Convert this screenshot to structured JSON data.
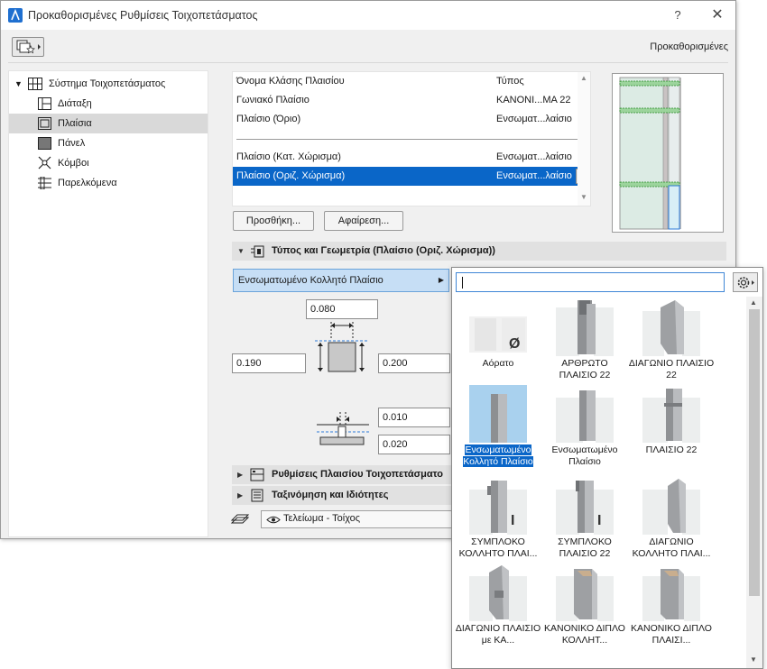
{
  "window": {
    "title": "Προκαθορισμένες Ρυθμίσεις Τοιχοπετάσματος",
    "help": "?",
    "close": "✕",
    "defaults_label": "Προκαθορισμένες"
  },
  "tree": {
    "root": "Σύστημα Τοιχοπετάσματος",
    "items": [
      {
        "label": "Διάταξη",
        "icon": "layout-icon"
      },
      {
        "label": "Πλαίσια",
        "icon": "frames-icon",
        "selected": true
      },
      {
        "label": "Πάνελ",
        "icon": "panel-icon"
      },
      {
        "label": "Κόμβοι",
        "icon": "junctions-icon"
      },
      {
        "label": "Παρελκόμενα",
        "icon": "accessories-icon"
      }
    ]
  },
  "frame_list": {
    "header": {
      "name": "Όνομα Κλάσης Πλαισίου",
      "type": "Τύπος"
    },
    "rows": [
      {
        "name": "Γωνιακό Πλαίσιο",
        "type": "ΚΑΝΟΝΙ...ΜΑ 22"
      },
      {
        "name": "Πλαίσιο (Όριο)",
        "type": "Ενσωματ...λαίσιο"
      },
      {
        "name": "Πλαίσιο (Κατ. Χώρισμα)",
        "type": "Ενσωματ...λαίσιο"
      },
      {
        "name": "Πλαίσιο (Οριζ. Χώρισμα)",
        "type": "Ενσωματ...λαίσιο",
        "selected": true
      }
    ]
  },
  "buttons": {
    "add": "Προσθήκη...",
    "remove": "Αφαίρεση..."
  },
  "sections": {
    "type_geometry": "Τύπος και Γεωμετρία (Πλαίσιο (Οριζ. Χώρισμα))",
    "frame_settings": "Ρυθμίσεις Πλαισίου Τοιχοπετάσματο",
    "classification": "Ταξινόμηση και Ιδιότητες"
  },
  "frame_type": "Ενσωματωμένο Κολλητό Πλαίσιο",
  "dimensions": {
    "top": "0.080",
    "left": "0.190",
    "right": "0.200",
    "offset_1": "0.010",
    "offset_2": "0.020"
  },
  "surface": {
    "label": "Τελείωμα - Τοίχος"
  },
  "popup": {
    "search_value": "",
    "tiles": [
      {
        "label": "Αόρατο",
        "badge": "Ø"
      },
      {
        "label": "ΑΡΘΡΩΤΟ ΠΛΑΙΣΙΟ 22"
      },
      {
        "label": "ΔΙΑΓΩΝΙΟ ΠΛΑΙΣΙΟ 22"
      },
      {
        "label": "Ενσωματωμένο Κολλητό Πλαίσιο",
        "selected": true
      },
      {
        "label": "Ενσωματωμένο Πλαίσιο"
      },
      {
        "label": "ΠΛΑΙΣΙΟ 22"
      },
      {
        "label": "ΣΥΜΠΛΟΚΟ ΚΟΛΛΗΤΟ ΠΛΑΙ...",
        "badge": "I"
      },
      {
        "label": "ΣΥΜΠΛΟΚΟ ΠΛΑΙΣΙΟ 22",
        "badge": "I"
      },
      {
        "label": "ΔΙΑΓΩΝΙΟ ΚΟΛΛΗΤΟ ΠΛΑΙ..."
      },
      {
        "label": "ΔΙΑΓΩΝΙΟ ΠΛΑΙΣΙΟ με ΚΑ..."
      },
      {
        "label": "ΚΑΝΟΝΙΚΟ ΔΙΠΛΟ ΚΟΛΛΗΤ..."
      },
      {
        "label": "ΚΑΝΟΝΙΚΟ ΔΙΠΛΟ ΠΛΑΙΣΙ..."
      }
    ]
  },
  "colors": {
    "selection": "#0a66c8",
    "selected_field": "#c6def5"
  }
}
